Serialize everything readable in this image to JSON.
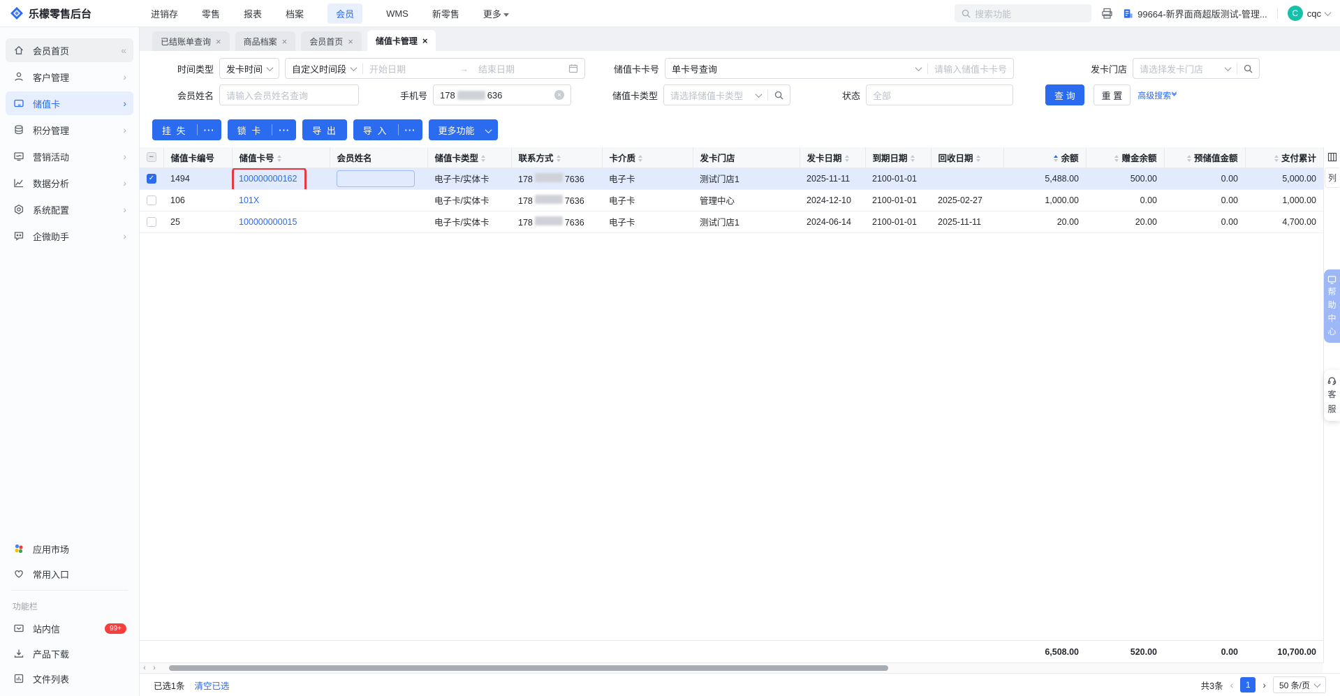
{
  "colors": {
    "primary": "#2b6bf0",
    "annotation_red": "#e5383f",
    "badge_red": "#f53f3f",
    "avatar_teal": "#17c0a9",
    "selected_row": "#e1ebfd"
  },
  "topbar": {
    "logo_text": "乐檬零售后台",
    "nav": [
      {
        "label": "进销存"
      },
      {
        "label": "零售"
      },
      {
        "label": "报表"
      },
      {
        "label": "档案"
      },
      {
        "label": "会员"
      },
      {
        "label": "WMS"
      },
      {
        "label": "新零售"
      },
      {
        "label": "更多"
      }
    ],
    "search_placeholder": "搜索功能",
    "company": "99664-新界面商超版测试-管理...",
    "user": {
      "initial": "C",
      "name": "cqc"
    }
  },
  "sidebar": {
    "items": [
      {
        "label": "会员首页"
      },
      {
        "label": "客户管理"
      },
      {
        "label": "储值卡"
      },
      {
        "label": "积分管理"
      },
      {
        "label": "营销活动"
      },
      {
        "label": "数据分析"
      },
      {
        "label": "系统配置"
      },
      {
        "label": "企微助手"
      }
    ],
    "secondary": [
      {
        "label": "应用市场"
      },
      {
        "label": "常用入口"
      }
    ],
    "section_label": "功能栏",
    "tools": [
      {
        "label": "站内信",
        "badge": "99+"
      },
      {
        "label": "产品下载"
      },
      {
        "label": "文件列表"
      }
    ]
  },
  "tabs": [
    {
      "label": "已结账单查询"
    },
    {
      "label": "商品档案"
    },
    {
      "label": "会员首页"
    },
    {
      "label": "储值卡管理"
    }
  ],
  "filters": {
    "time_type_label": "时间类型",
    "time_type_value": "发卡时间",
    "range_mode_value": "自定义时间段",
    "start_placeholder": "开始日期",
    "range_arrow": "→",
    "end_placeholder": "结束日期",
    "card_no_label": "储值卡卡号",
    "card_no_mode": "单卡号查询",
    "card_no_placeholder": "请输入储值卡卡号",
    "store_label": "发卡门店",
    "store_placeholder": "请选择发卡门店",
    "member_label": "会员姓名",
    "member_placeholder": "请输入会员姓名查询",
    "phone_label": "手机号",
    "phone_prefix": "178",
    "phone_suffix": "636",
    "card_type_label": "储值卡类型",
    "card_type_placeholder": "请选择储值卡类型",
    "status_label": "状态",
    "status_value": "全部",
    "query_btn": "查 询",
    "reset_btn": "重 置",
    "advanced_search": "高级搜索"
  },
  "actions": {
    "loss": "挂 失",
    "lock": "锁 卡",
    "export": "导 出",
    "import": "导 入",
    "more": "更多功能",
    "dots": "···"
  },
  "table": {
    "columns": [
      {
        "label": "储值卡编号"
      },
      {
        "label": "储值卡号"
      },
      {
        "label": "会员姓名"
      },
      {
        "label": "储值卡类型"
      },
      {
        "label": "联系方式"
      },
      {
        "label": "卡介质"
      },
      {
        "label": "发卡门店"
      },
      {
        "label": "发卡日期"
      },
      {
        "label": "到期日期"
      },
      {
        "label": "回收日期"
      },
      {
        "label": "余额"
      },
      {
        "label": "赠金余额"
      },
      {
        "label": "预储值金额"
      },
      {
        "label": "支付累计"
      }
    ],
    "rows": [
      {
        "id": "1494",
        "card_no": "100000000162",
        "member_name": "",
        "card_type": "电子卡/实体卡",
        "phone_prefix": "178",
        "phone_suffix": "7636",
        "medium": "电子卡",
        "store": "测试门店1",
        "issue_date": "2025-11-11",
        "expire_date": "2100-01-01",
        "recycle_date": "",
        "balance": "5,488.00",
        "gift_balance": "500.00",
        "prestore_amount": "0.00",
        "pay_total": "5,000.00"
      },
      {
        "id": "106",
        "card_no": "101X",
        "member_name": "",
        "card_type": "电子卡/实体卡",
        "phone_prefix": "178",
        "phone_suffix": "7636",
        "medium": "电子卡",
        "store": "管理中心",
        "issue_date": "2024-12-10",
        "expire_date": "2100-01-01",
        "recycle_date": "2025-02-27",
        "balance": "1,000.00",
        "gift_balance": "0.00",
        "prestore_amount": "0.00",
        "pay_total": "1,000.00"
      },
      {
        "id": "25",
        "card_no": "100000000015",
        "member_name": "",
        "card_type": "电子卡/实体卡",
        "phone_prefix": "178",
        "phone_suffix": "7636",
        "medium": "电子卡",
        "store": "测试门店1",
        "issue_date": "2024-06-14",
        "expire_date": "2100-01-01",
        "recycle_date": "2025-11-11",
        "balance": "20.00",
        "gift_balance": "20.00",
        "prestore_amount": "0.00",
        "pay_total": "4,700.00"
      }
    ],
    "totals": {
      "balance": "6,508.00",
      "gift_balance": "520.00",
      "prestore_amount": "0.00",
      "pay_total": "10,700.00"
    },
    "column_tab": "列"
  },
  "footer": {
    "selected_text": "已选1条",
    "clear_selected": "清空已选",
    "total_text": "共3条",
    "page": "1",
    "page_size": "50 条/页"
  },
  "floaters": {
    "help": "帮助中心",
    "service": "客服"
  }
}
